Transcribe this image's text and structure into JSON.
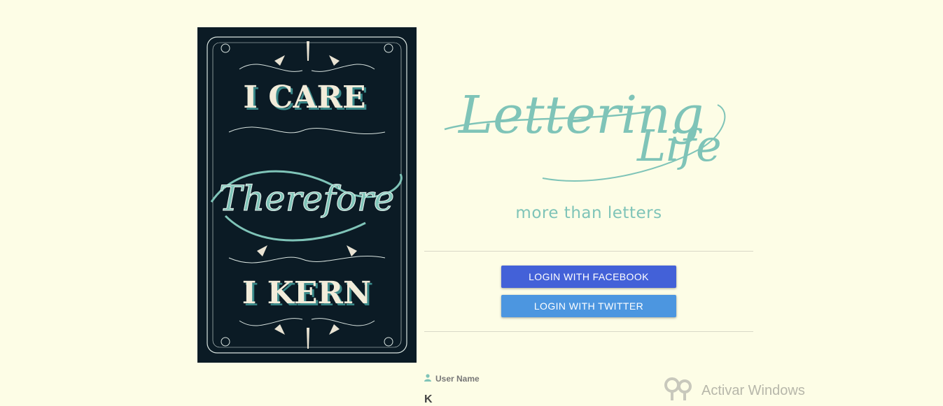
{
  "poster": {
    "line1": "I CARE",
    "script": "Therefore",
    "line2": "I KERN"
  },
  "brand": {
    "logo_word1": "Lettering",
    "logo_word2": "Life",
    "tagline": "more than letters"
  },
  "auth": {
    "facebook_label": "LOGIN WITH FACEBOOK",
    "twitter_label": "LOGIN WITH TWITTER"
  },
  "form": {
    "username_label": "User Name",
    "next_label_partial": "K"
  },
  "os_watermark": {
    "text": "Activar Windows"
  },
  "colors": {
    "background": "#fdfde6",
    "poster_bg": "#0b1b25",
    "accent_teal": "#7fc4b8",
    "facebook_blue": "#4361d8",
    "twitter_blue": "#4c96e0"
  }
}
